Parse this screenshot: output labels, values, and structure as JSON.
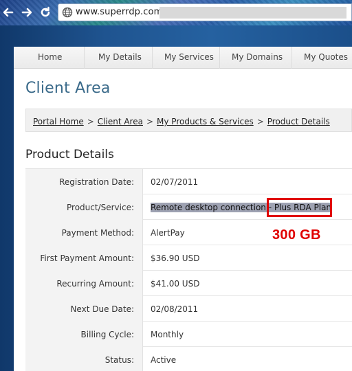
{
  "browser": {
    "url": "www.superrdp.com"
  },
  "nav": {
    "items": [
      "Home",
      "My Details",
      "My Services",
      "My Domains",
      "My Quotes"
    ]
  },
  "page_title": "Client Area",
  "breadcrumb": {
    "items": [
      "Portal Home",
      "Client Area",
      "My Products & Services",
      "Product Details"
    ],
    "separator": ">"
  },
  "section_title": "Product Details",
  "details": {
    "rows": [
      {
        "label": "Registration Date:",
        "value": "02/07/2011"
      },
      {
        "label": "Product/Service:",
        "value_highlight": "Remote desktop connection - Plus RDA Plan"
      },
      {
        "label": "Payment Method:",
        "value": "AlertPay"
      },
      {
        "label": "First Payment Amount:",
        "value": "$36.90 USD"
      },
      {
        "label": "Recurring Amount:",
        "value": "$41.00 USD"
      },
      {
        "label": "Next Due Date:",
        "value": "02/08/2011"
      },
      {
        "label": "Billing Cycle:",
        "value": "Monthly"
      },
      {
        "label": "Status:",
        "value": "Active"
      }
    ]
  },
  "annotation": {
    "note": "300 GB",
    "color": "#e00000"
  },
  "colors": {
    "title": "#3a6a8a",
    "selection": "#9ea2b2",
    "frame": "#1c4f86"
  }
}
